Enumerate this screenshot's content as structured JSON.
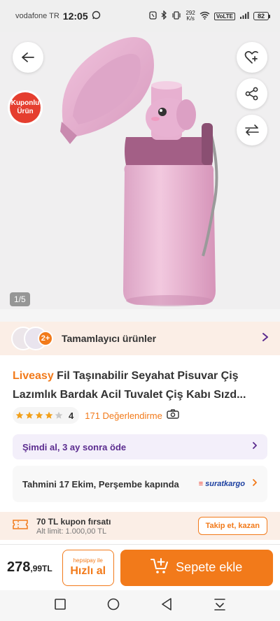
{
  "status": {
    "carrier": "vodafone TR",
    "time": "12:05",
    "speed_value": "292",
    "speed_unit": "K/s",
    "volte": "VoLTE",
    "battery": "82"
  },
  "gallery": {
    "coupon_badge_line1": "Kuponlu",
    "coupon_badge_line2": "Ürün",
    "counter": "1/5"
  },
  "complementary": {
    "plus_badge": "2+",
    "label": "Tamamlayıcı ürünler"
  },
  "product": {
    "brand": "Liveasy",
    "title_line1": "Fil Taşınabilir Seyahat Pisuvar Çiş",
    "title_line2": "Lazımlık Bardak Acil Tuvalet Çiş Kabı Sızd...",
    "rating": 4,
    "rating_text": "4",
    "review_count": "171 Değerlendirme"
  },
  "installment": {
    "text": "Şimdi al, 3 ay sonra öde"
  },
  "delivery": {
    "text": "Tahmini 17 Ekim, Perşembe kapında",
    "carrier_logo_text": "suratkargo"
  },
  "coupon": {
    "title": "70 TL kupon fırsatı",
    "limit": "Alt limit: 1.000,00 TL",
    "button": "Takip et, kazan"
  },
  "purchase": {
    "price_main": "278",
    "price_decimal": ",99TL",
    "hepsipay_label": "hepsipay ile",
    "hepsipay_button": "Hızlı al",
    "add_to_cart": "Sepete ekle"
  },
  "colors": {
    "accent": "#f27a1a",
    "purple": "#5b2c8f",
    "product_pink": "#e8b4d0"
  }
}
